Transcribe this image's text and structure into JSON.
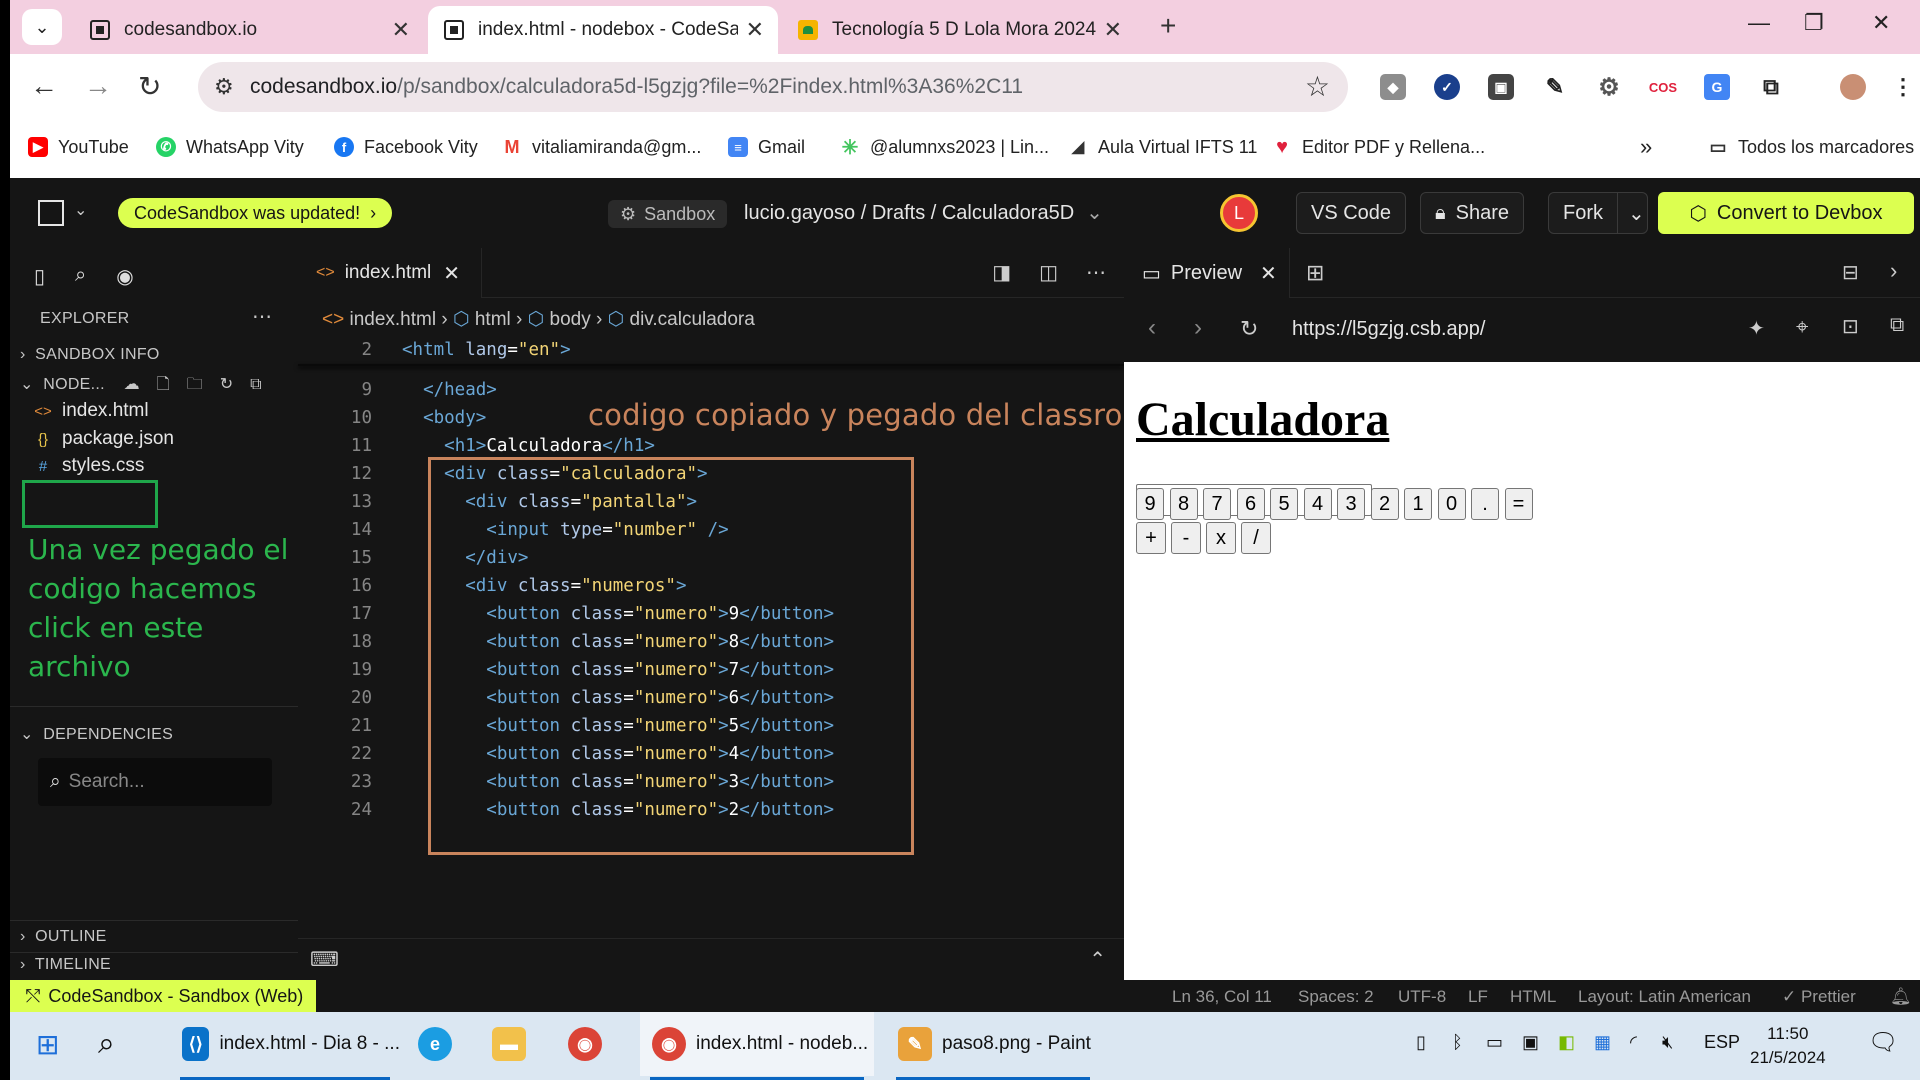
{
  "browser": {
    "tabs": [
      {
        "title": "codesandbox.io",
        "active": false
      },
      {
        "title": "index.html - nodebox - CodeSa",
        "active": true
      },
      {
        "title": "Tecnología 5 D Lola Mora 2024",
        "active": false
      }
    ],
    "url_host": "codesandbox.io",
    "url_path": "/p/sandbox/calculadora5d-l5gzjg?file=%2Findex.html%3A36%2C11",
    "bookmarks": [
      {
        "label": "YouTube",
        "icon": "youtube-icon",
        "color": "#ff0000"
      },
      {
        "label": "WhatsApp Vity",
        "icon": "whatsapp-icon",
        "color": "#25d366"
      },
      {
        "label": "Facebook Vity",
        "icon": "facebook-icon",
        "color": "#1877f2"
      },
      {
        "label": "vitaliamiranda@gm...",
        "icon": "gmail-icon",
        "color": "#ea4335"
      },
      {
        "label": "Gmail",
        "icon": "docs-icon",
        "color": "#4285f4"
      },
      {
        "label": "@alumnxs2023 | Lin...",
        "icon": "linktree-icon",
        "color": "#43e55e"
      },
      {
        "label": "Aula Virtual IFTS 11",
        "icon": "aula-icon",
        "color": "#333333"
      },
      {
        "label": "Editor PDF y Rellena...",
        "icon": "heart-icon",
        "color": "#e0213d"
      }
    ],
    "bookmarks_more": "»",
    "all_bookmarks": "Todos los marcadores"
  },
  "csb": {
    "updated_label": "CodeSandbox was updated!",
    "sandbox_label": "Sandbox",
    "breadcrumb": "lucio.gayoso / Drafts / Calculadora5D",
    "avatar_letter": "L",
    "vscode_label": "VS Code",
    "share_label": "Share",
    "fork_label": "Fork",
    "convert_label": "Convert to Devbox"
  },
  "sidebar": {
    "explorer_label": "EXPLORER",
    "sandbox_info": "SANDBOX INFO",
    "node_label": "NODE...",
    "files": [
      {
        "name": "index.html",
        "icon": "<>",
        "color": "#e08a3b"
      },
      {
        "name": "package.json",
        "icon": "{}",
        "color": "#e6c34b"
      },
      {
        "name": "styles.css",
        "icon": "#",
        "color": "#5aa9e6"
      }
    ],
    "annotation": "Una vez pegado el codigo hacemos click en este archivo",
    "dependencies_label": "DEPENDENCIES",
    "search_placeholder": "Search...",
    "outline_label": "OUTLINE",
    "timeline_label": "TIMELINE"
  },
  "editor": {
    "tab_name": "index.html",
    "crumbs": [
      "index.html",
      "html",
      "body",
      "div.calculadora"
    ],
    "annotation": "codigo copiado y pegado del classroom",
    "lines": [
      {
        "n": "2",
        "indent": "",
        "parts": [
          [
            "tg",
            "<html "
          ],
          [
            "at",
            "lang"
          ],
          [
            "tx",
            "="
          ],
          [
            "st",
            "\"en\""
          ],
          [
            "tg",
            ">"
          ]
        ]
      },
      {
        "n": "9",
        "indent": "  ",
        "parts": [
          [
            "tg",
            "</head>"
          ]
        ]
      },
      {
        "n": "10",
        "indent": "  ",
        "parts": [
          [
            "tg",
            "<body>"
          ]
        ]
      },
      {
        "n": "11",
        "indent": "    ",
        "parts": [
          [
            "tg",
            "<h1>"
          ],
          [
            "tx",
            "Calculadora"
          ],
          [
            "tg",
            "</h1>"
          ]
        ]
      },
      {
        "n": "12",
        "indent": "    ",
        "parts": [
          [
            "tg",
            "<div "
          ],
          [
            "at",
            "class"
          ],
          [
            "tx",
            "="
          ],
          [
            "st",
            "\"calculadora\""
          ],
          [
            "tg",
            ">"
          ]
        ]
      },
      {
        "n": "13",
        "indent": "      ",
        "parts": [
          [
            "tg",
            "<div "
          ],
          [
            "at",
            "class"
          ],
          [
            "tx",
            "="
          ],
          [
            "st",
            "\"pantalla\""
          ],
          [
            "tg",
            ">"
          ]
        ]
      },
      {
        "n": "14",
        "indent": "        ",
        "parts": [
          [
            "tg",
            "<input "
          ],
          [
            "at",
            "type"
          ],
          [
            "tx",
            "="
          ],
          [
            "st",
            "\"number\""
          ],
          [
            "tg",
            " />"
          ]
        ]
      },
      {
        "n": "15",
        "indent": "      ",
        "parts": [
          [
            "tg",
            "</div>"
          ]
        ]
      },
      {
        "n": "16",
        "indent": "      ",
        "parts": [
          [
            "tg",
            "<div "
          ],
          [
            "at",
            "class"
          ],
          [
            "tx",
            "="
          ],
          [
            "st",
            "\"numeros\""
          ],
          [
            "tg",
            ">"
          ]
        ]
      },
      {
        "n": "17",
        "indent": "        ",
        "parts": [
          [
            "tg",
            "<button "
          ],
          [
            "at",
            "class"
          ],
          [
            "tx",
            "="
          ],
          [
            "st",
            "\"numero\""
          ],
          [
            "tg",
            ">"
          ],
          [
            "tx",
            "9"
          ],
          [
            "tg",
            "</button>"
          ]
        ]
      },
      {
        "n": "18",
        "indent": "        ",
        "parts": [
          [
            "tg",
            "<button "
          ],
          [
            "at",
            "class"
          ],
          [
            "tx",
            "="
          ],
          [
            "st",
            "\"numero\""
          ],
          [
            "tg",
            ">"
          ],
          [
            "tx",
            "8"
          ],
          [
            "tg",
            "</button>"
          ]
        ]
      },
      {
        "n": "19",
        "indent": "        ",
        "parts": [
          [
            "tg",
            "<button "
          ],
          [
            "at",
            "class"
          ],
          [
            "tx",
            "="
          ],
          [
            "st",
            "\"numero\""
          ],
          [
            "tg",
            ">"
          ],
          [
            "tx",
            "7"
          ],
          [
            "tg",
            "</button>"
          ]
        ]
      },
      {
        "n": "20",
        "indent": "        ",
        "parts": [
          [
            "tg",
            "<button "
          ],
          [
            "at",
            "class"
          ],
          [
            "tx",
            "="
          ],
          [
            "st",
            "\"numero\""
          ],
          [
            "tg",
            ">"
          ],
          [
            "tx",
            "6"
          ],
          [
            "tg",
            "</button>"
          ]
        ]
      },
      {
        "n": "21",
        "indent": "        ",
        "parts": [
          [
            "tg",
            "<button "
          ],
          [
            "at",
            "class"
          ],
          [
            "tx",
            "="
          ],
          [
            "st",
            "\"numero\""
          ],
          [
            "tg",
            ">"
          ],
          [
            "tx",
            "5"
          ],
          [
            "tg",
            "</button>"
          ]
        ]
      },
      {
        "n": "22",
        "indent": "        ",
        "parts": [
          [
            "tg",
            "<button "
          ],
          [
            "at",
            "class"
          ],
          [
            "tx",
            "="
          ],
          [
            "st",
            "\"numero\""
          ],
          [
            "tg",
            ">"
          ],
          [
            "tx",
            "4"
          ],
          [
            "tg",
            "</button>"
          ]
        ]
      },
      {
        "n": "23",
        "indent": "        ",
        "parts": [
          [
            "tg",
            "<button "
          ],
          [
            "at",
            "class"
          ],
          [
            "tx",
            "="
          ],
          [
            "st",
            "\"numero\""
          ],
          [
            "tg",
            ">"
          ],
          [
            "tx",
            "3"
          ],
          [
            "tg",
            "</button>"
          ]
        ]
      },
      {
        "n": "24",
        "indent": "        ",
        "parts": [
          [
            "tg",
            "<button "
          ],
          [
            "at",
            "class"
          ],
          [
            "tx",
            "="
          ],
          [
            "st",
            "\"numero\""
          ],
          [
            "tg",
            ">"
          ],
          [
            "tx",
            "2"
          ],
          [
            "tg",
            "</button>"
          ]
        ]
      }
    ]
  },
  "preview": {
    "tab_label": "Preview",
    "url": "https://l5gzjg.csb.app/",
    "heading": "Calculadora",
    "row1": [
      "9",
      "8",
      "7",
      "6",
      "5",
      "4",
      "3",
      "2",
      "1",
      "0",
      ".",
      "="
    ],
    "row2": [
      "+",
      "-",
      "x",
      "/"
    ]
  },
  "status": {
    "left": "CodeSandbox - Sandbox (Web)",
    "position": "Ln 36, Col 11",
    "spaces": "Spaces: 2",
    "encoding": "UTF-8",
    "eol": "LF",
    "language": "HTML",
    "layout": "Layout: Latin American",
    "prettier": "✓ Prettier"
  },
  "taskbar": {
    "items": [
      {
        "label": "index.html - Dia 8 - ...",
        "icon": "vscode-icon",
        "color": "#0a72c9"
      },
      {
        "label": "index.html - nodeb...",
        "icon": "chrome-icon",
        "color": "#db4437"
      },
      {
        "label": "paso8.png - Paint",
        "icon": "paint-icon",
        "color": "#e9a23b"
      }
    ],
    "lang": "ESP",
    "time": "11:50",
    "date": "21/5/2024"
  }
}
